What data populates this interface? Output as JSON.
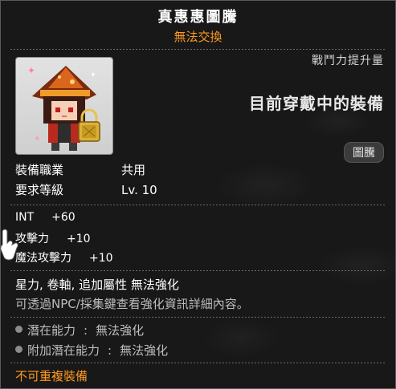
{
  "item": {
    "name": "真惠惠圖騰",
    "trade": "無法交換",
    "cp_label": "戰鬥力提升量",
    "equipped_label": "目前穿戴中的裝備",
    "job_badge": "圖騰"
  },
  "requirements": [
    {
      "key": "裝備職業",
      "value": "共用"
    },
    {
      "key": "要求等級",
      "value": "Lv. 10"
    }
  ],
  "stats": [
    {
      "key": "INT",
      "value": "+60"
    },
    {
      "key": "攻擊力",
      "value": "+10"
    },
    {
      "key": "魔法攻擊力",
      "value": "+10"
    }
  ],
  "flags": "星力, 卷軸, 追加屬性 無法強化",
  "description": "可透過NPC/採集鍵查看強化資訊詳細內容。",
  "potentials": [
    {
      "key": "潛在能力",
      "value": "無法強化"
    },
    {
      "key": "附加潛在能力",
      "value": "無法強化"
    }
  ],
  "warning": "不可重複裝備",
  "colors": {
    "accent": "#ff9a1f",
    "text": "#ffffff",
    "muted": "#bdbdbd",
    "panel": "#161616"
  },
  "icons": [
    "megumin-totem-icon",
    "lock-icon",
    "hand-cursor-icon",
    "bullet-dot-icon"
  ]
}
